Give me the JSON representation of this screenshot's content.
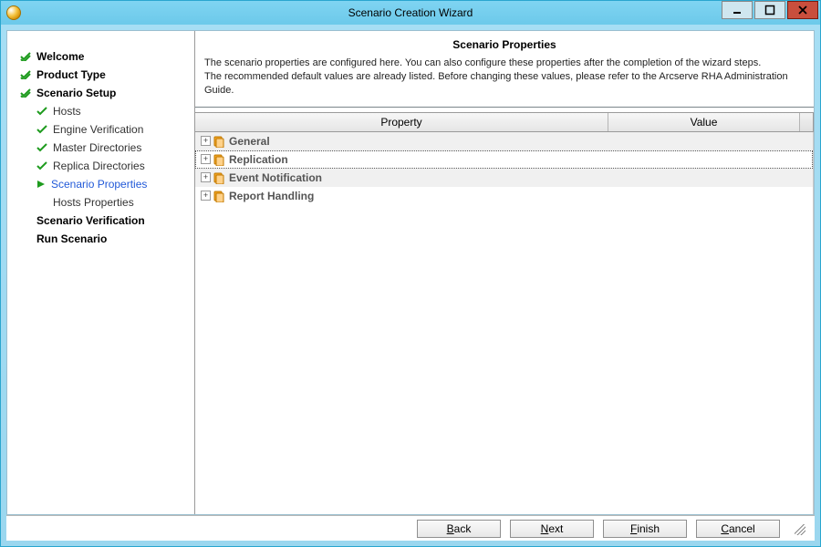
{
  "window": {
    "title": "Scenario Creation Wizard"
  },
  "nav": {
    "items": [
      {
        "label": "Welcome",
        "kind": "top",
        "icon": "dblcheck"
      },
      {
        "label": "Product Type",
        "kind": "top",
        "icon": "dblcheck"
      },
      {
        "label": "Scenario Setup",
        "kind": "top",
        "icon": "dblcheck"
      },
      {
        "label": "Hosts",
        "kind": "sub",
        "icon": "check"
      },
      {
        "label": "Engine Verification",
        "kind": "sub",
        "icon": "check"
      },
      {
        "label": "Master Directories",
        "kind": "sub",
        "icon": "check"
      },
      {
        "label": "Replica Directories",
        "kind": "sub",
        "icon": "check"
      },
      {
        "label": "Scenario Properties",
        "kind": "sub",
        "icon": "arrow",
        "active": true
      },
      {
        "label": "Hosts Properties",
        "kind": "sub",
        "icon": "none"
      },
      {
        "label": "Scenario Verification",
        "kind": "top",
        "icon": "none"
      },
      {
        "label": "Run Scenario",
        "kind": "top",
        "icon": "none"
      }
    ]
  },
  "header": {
    "title": "Scenario Properties",
    "line1": "The scenario properties are configured here. You can also configure these properties after the completion of the wizard steps.",
    "line2": "The recommended default values are already listed. Before changing these values, please refer to the Arcserve RHA Administration Guide."
  },
  "grid": {
    "columns": {
      "property": "Property",
      "value": "Value"
    },
    "rows": [
      {
        "label": "General",
        "selected": false
      },
      {
        "label": "Replication",
        "selected": true
      },
      {
        "label": "Event Notification",
        "selected": false
      },
      {
        "label": "Report Handling",
        "selected": false
      }
    ]
  },
  "footer": {
    "back": {
      "pre": "",
      "u": "B",
      "post": "ack"
    },
    "next": {
      "pre": "",
      "u": "N",
      "post": "ext"
    },
    "finish": {
      "pre": "",
      "u": "F",
      "post": "inish"
    },
    "cancel": {
      "pre": "",
      "u": "C",
      "post": "ancel"
    }
  }
}
